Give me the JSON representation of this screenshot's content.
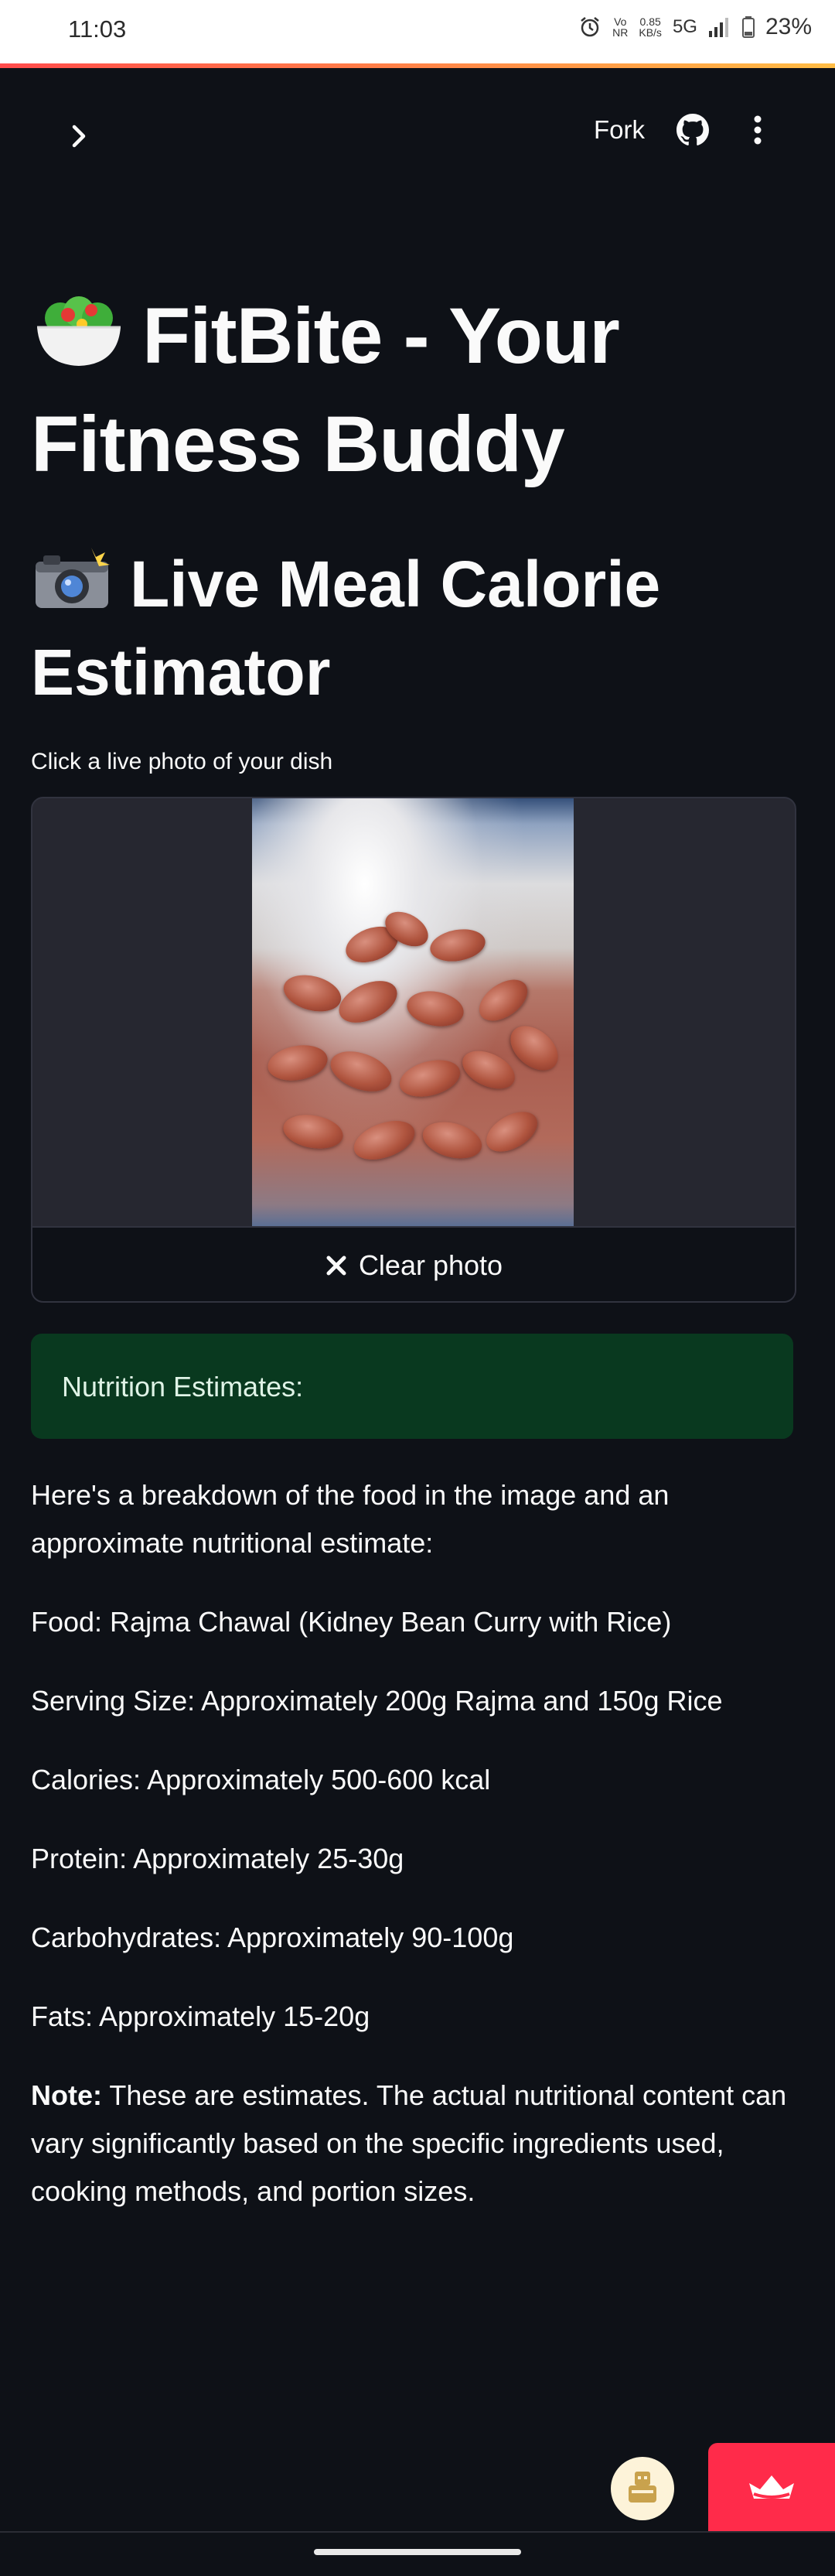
{
  "status_bar": {
    "time": "11:03",
    "net_speed_top": "0.85",
    "net_speed_bottom": "KB/s",
    "network": "5G",
    "volte": "Vo",
    "volte2": "NR",
    "battery": "23%"
  },
  "toolbar": {
    "fork_label": "Fork"
  },
  "page": {
    "title": "FitBite - Your Fitness Buddy",
    "title_emoji": "🥗",
    "section_title": "Live Meal Calorie Estimator",
    "section_emoji": "📸"
  },
  "camera": {
    "label": "Click a live photo of your dish",
    "clear_label": "Clear photo",
    "clear_icon": "close-icon"
  },
  "result": {
    "success_text": "Nutrition Estimates:",
    "intro": "Here's a breakdown of the food in the image and an approximate nutritional estimate:",
    "food": "Food: Rajma Chawal (Kidney Bean Curry with Rice)",
    "serving": "Serving Size: Approximately 200g Rajma and 150g Rice",
    "calories": "Calories: Approximately 500-600 kcal",
    "protein": "Protein: Approximately 25-30g",
    "carbs": "Carbohydrates: Approximately 90-100g",
    "fats": "Fats: Approximately 15-20g",
    "note_label": "Note:",
    "note_text": " These are estimates. The actual nutritional content can vary significantly based on the specific ingredients used, cooking methods, and portion sizes."
  },
  "colors": {
    "background": "#0e1117",
    "success_bg": "#09391f",
    "accent": "#ff2b4a"
  }
}
